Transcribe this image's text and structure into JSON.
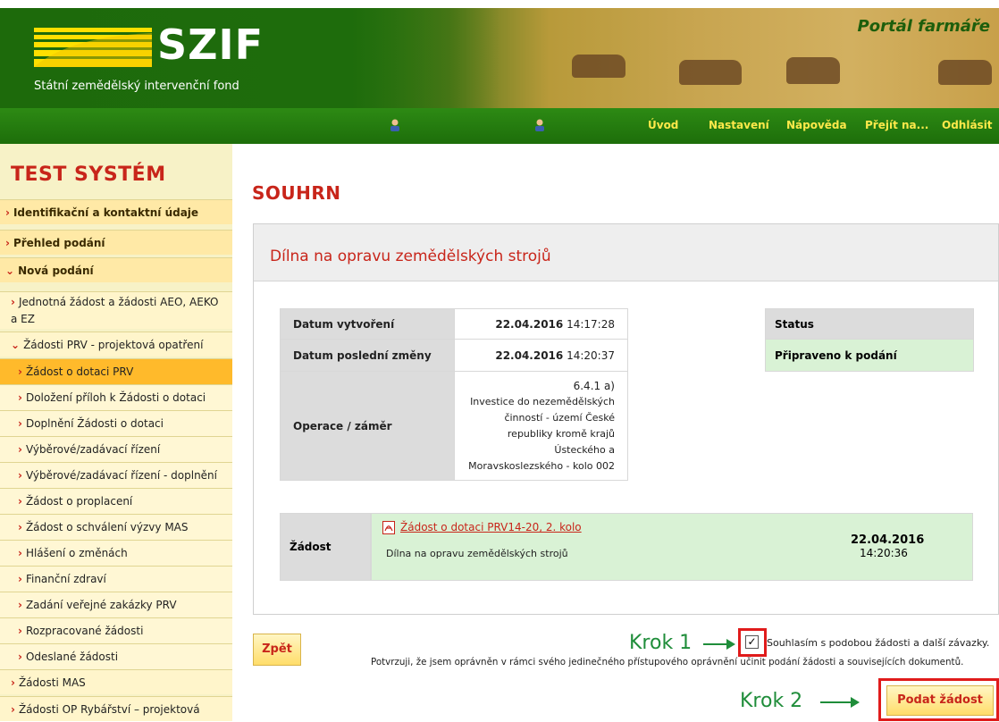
{
  "header": {
    "logo_text": "SZIF",
    "org_name": "Státní zemědělský intervenční fond",
    "portal_title": "Portál farmáře"
  },
  "nav": {
    "items": [
      "Úvod",
      "Nastavení",
      "Nápověda",
      "Přejít na...",
      "Odhlásit"
    ]
  },
  "sidebar": {
    "system_title": "TEST SYSTÉM",
    "items": [
      {
        "label": "Identifikační a kontaktní údaje",
        "level": 1
      },
      {
        "label": "Přehled podání",
        "level": 1
      },
      {
        "label": "Nová podání",
        "level": 1
      },
      {
        "label": "Jednotná žádost a žádosti AEO, AEKO a EZ",
        "level": 2
      },
      {
        "label": "Žádosti PRV - projektová opatření",
        "level": 2
      },
      {
        "label": "Žádost o dotaci PRV",
        "level": 3
      },
      {
        "label": "Doložení příloh k Žádosti o dotaci",
        "level": 3
      },
      {
        "label": "Doplnění Žádosti o dotaci",
        "level": 3
      },
      {
        "label": "Výběrové/zadávací řízení",
        "level": 3
      },
      {
        "label": "Výběrové/zadávací řízení - doplnění",
        "level": 3
      },
      {
        "label": "Žádost o proplacení",
        "level": 3
      },
      {
        "label": "Žádost o schválení výzvy MAS",
        "level": 3
      },
      {
        "label": "Hlášení o změnách",
        "level": 3
      },
      {
        "label": "Finanční zdraví",
        "level": 3
      },
      {
        "label": "Zadání veřejné zakázky PRV",
        "level": 3
      },
      {
        "label": "Rozpracované žádosti",
        "level": 3
      },
      {
        "label": "Odeslané žádosti",
        "level": 3
      },
      {
        "label": "Žádosti MAS",
        "level": 2
      },
      {
        "label": "Žádosti OP Rybářství – projektová",
        "level": 2
      }
    ]
  },
  "main": {
    "page_title": "SOUHRN",
    "panel_title": "Dílna na opravu zemědělských strojů",
    "info": {
      "created_label": "Datum vytvoření",
      "created_date": "22.04.2016",
      "created_time": "14:17:28",
      "changed_label": "Datum poslední změny",
      "changed_date": "22.04.2016",
      "changed_time": "14:20:37",
      "operation_label": "Operace / záměr",
      "operation_lines": [
        "6.4.1 a)",
        "Investice do nezemědělských",
        "činností - území České",
        "republiky kromě krajů",
        "Ústeckého a",
        "Moravskoslezského - kolo 002"
      ]
    },
    "status": {
      "header": "Status",
      "value": "Připraveno k podání"
    },
    "zadost": {
      "label": "Žádost",
      "link": "Žádost o dotaci PRV14-20, 2. kolo",
      "desc": "Dílna na opravu zemědělských strojů",
      "date": "22.04.2016",
      "time": "14:20:36"
    },
    "back_button": "Zpět",
    "consent_text": "Souhlasím s podobou žádosti a další závazky.",
    "confirm_text": "Potvrzuji, že jsem oprávněn v rámci svého jedinečného přístupového oprávnění učinit podání žádosti a souvisejících dokumentů.",
    "step1_label": "Krok 1",
    "step2_label": "Krok 2",
    "submit_button": "Podat žádost"
  },
  "colors": {
    "brand_green": "#1f6b0c",
    "nav_text": "#ffe94a",
    "accent_red": "#c8251a",
    "status_green": "#d9f2d5",
    "annotation_green": "#1f8d3a",
    "highlight_red": "#e01b1b"
  }
}
